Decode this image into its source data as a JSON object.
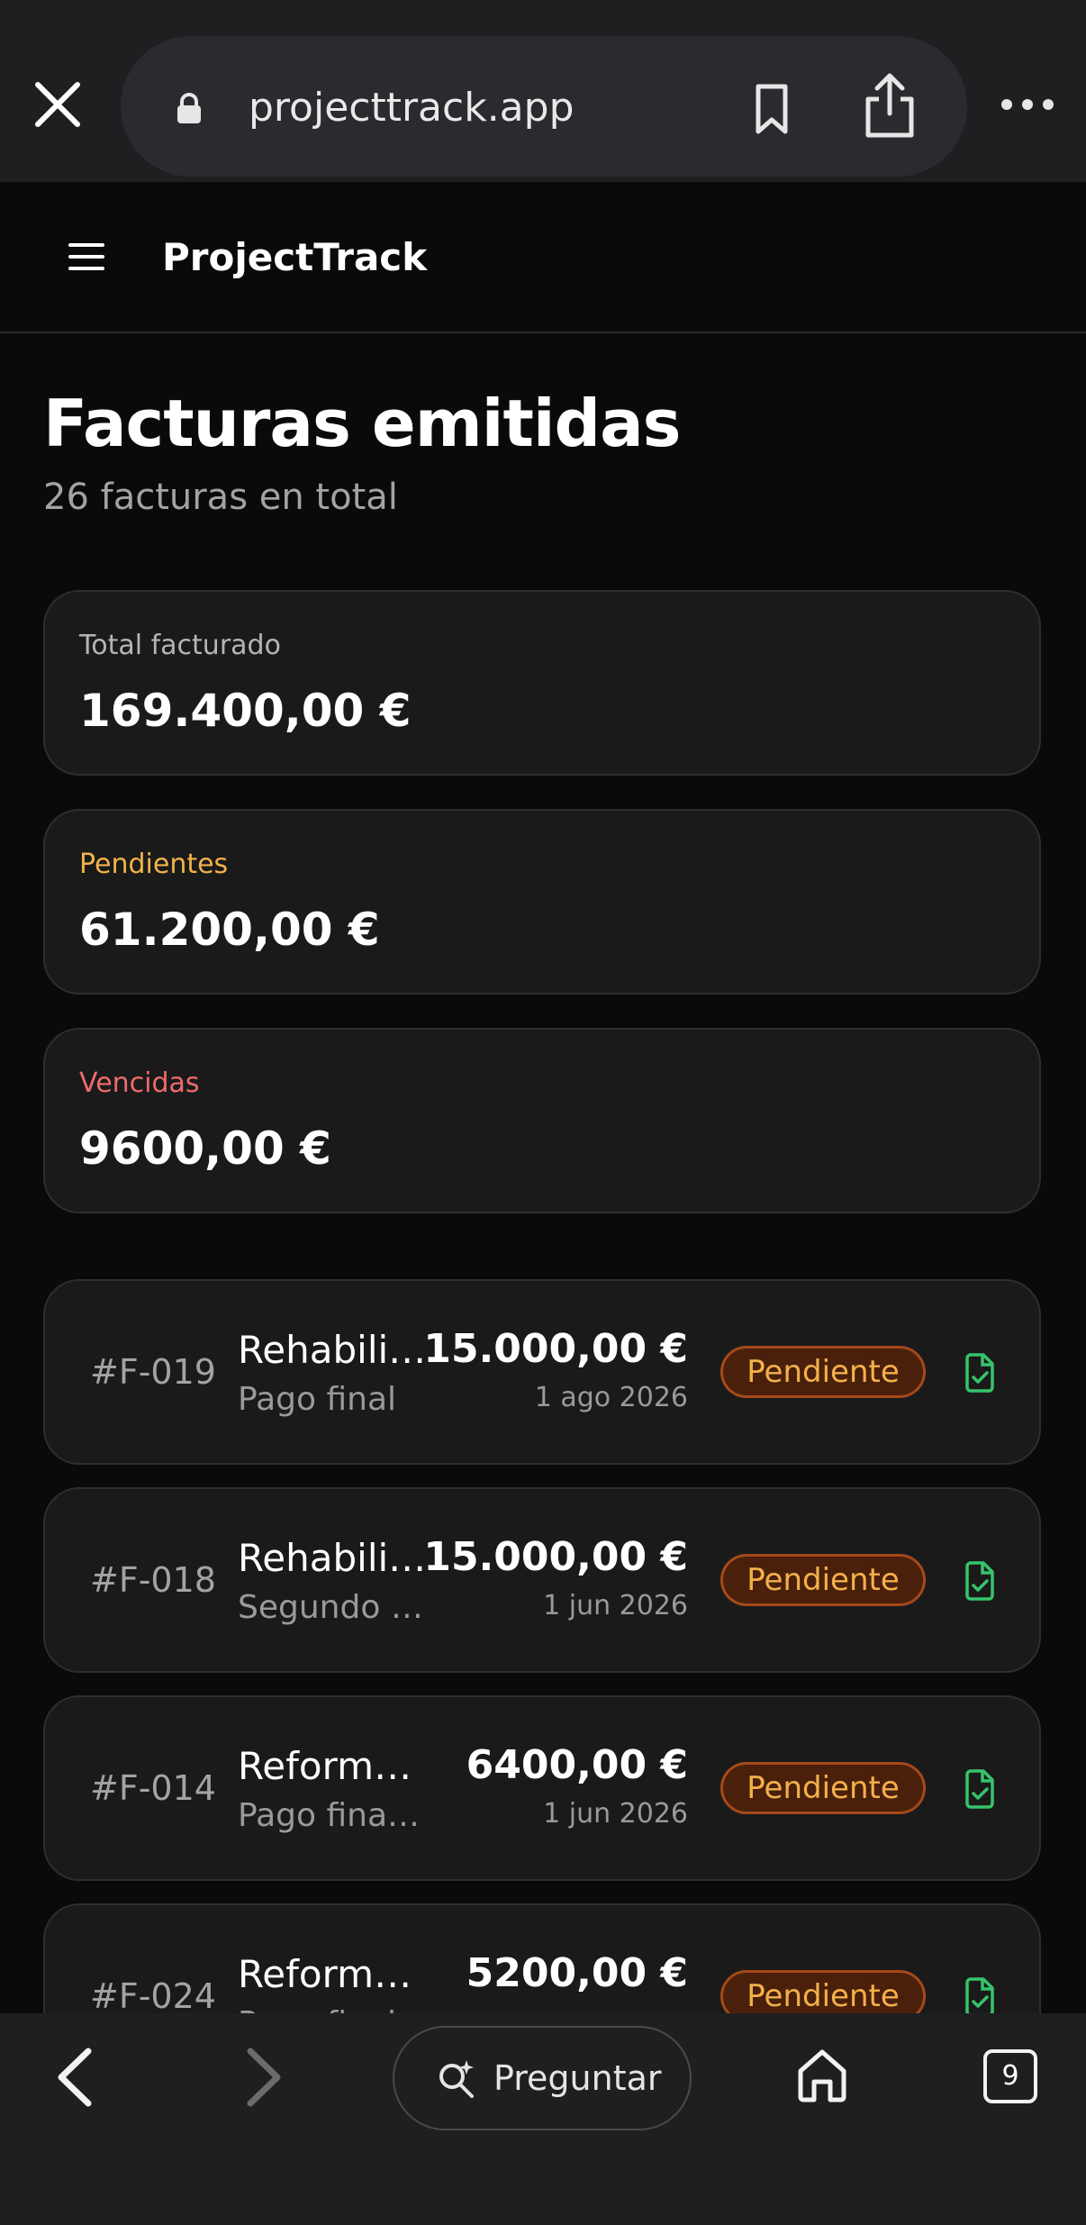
{
  "browser": {
    "url": "projecttrack.app",
    "ask_label": "Preguntar",
    "tab_count": "9"
  },
  "app": {
    "brand": "ProjectTrack"
  },
  "page": {
    "title": "Facturas emitidas",
    "subtitle": "26 facturas en total"
  },
  "stats": [
    {
      "label": "Total facturado",
      "value": "169.400,00 €",
      "label_color": "#b5b5b5"
    },
    {
      "label": "Pendientes",
      "value": "61.200,00 €",
      "label_color": "#f0b24a"
    },
    {
      "label": "Vencidas",
      "value": "9600,00 €",
      "label_color": "#ef6b6b"
    }
  ],
  "invoices": [
    {
      "id": "#F-019",
      "name": "Rehabilitación",
      "desc": "Pago final",
      "amount": "15.000,00 €",
      "date": "1 ago 2026",
      "status": "Pendiente"
    },
    {
      "id": "#F-018",
      "name": "Rehabilitación",
      "desc": "Segundo pago",
      "amount": "15.000,00 €",
      "date": "1 jun 2026",
      "status": "Pendiente"
    },
    {
      "id": "#F-014",
      "name": "Reforma local",
      "desc": "Pago final local",
      "amount": "6400,00 €",
      "date": "1 jun 2026",
      "status": "Pendiente"
    },
    {
      "id": "#F-024",
      "name": "Reforma total",
      "desc": "Pago final",
      "amount": "5200,00 €",
      "date": "",
      "status": "Pendiente"
    }
  ],
  "colors": {
    "pending_text": "#f3b14a",
    "pending_border": "#a5491a",
    "pending_bg": "#4a200c",
    "doc_icon": "#35c46a",
    "overdue": "#ef6b6b"
  }
}
